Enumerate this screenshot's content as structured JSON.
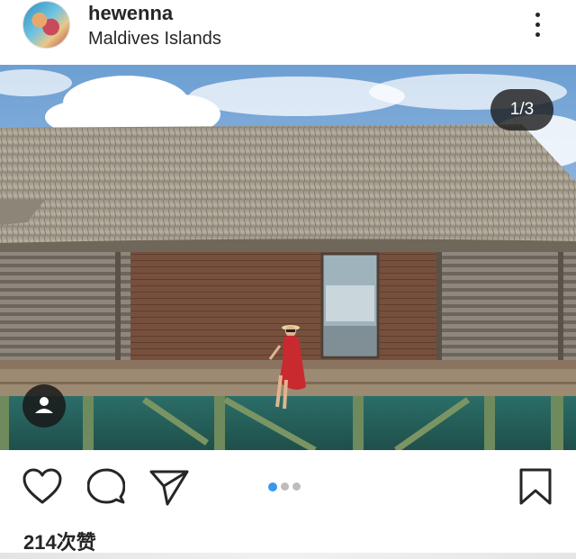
{
  "post": {
    "username": "hewenna",
    "location": "Maldives Islands",
    "counter": "1/3",
    "likes": "214次赞"
  },
  "carousel": {
    "count": 3,
    "active_index": 0,
    "active_color": "#3897f0",
    "inactive_color": "#bdbdbd"
  },
  "icons": {
    "more": "more-vertical-icon",
    "tag": "person-tag-icon",
    "like": "heart-icon",
    "comment": "comment-bubble-icon",
    "share": "send-paper-plane-icon",
    "save": "bookmark-icon"
  }
}
